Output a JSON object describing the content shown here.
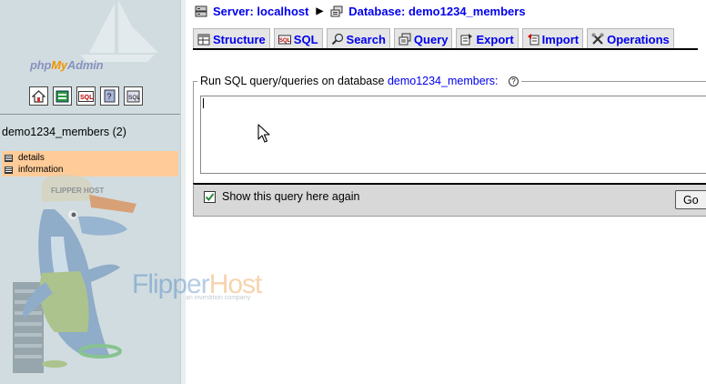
{
  "app": {
    "logo_php": "php",
    "logo_my": "My",
    "logo_admin": "Admin"
  },
  "left": {
    "icons": [
      "home-icon",
      "query-window-icon",
      "sql-icon",
      "help-icon",
      "docs-icon"
    ],
    "database_label": "demo1234_members (2)",
    "tables": [
      {
        "label": "details",
        "icon": "table-icon"
      },
      {
        "label": "information",
        "icon": "table-icon"
      }
    ],
    "watermark_brand": "FlipperHost",
    "watermark_brand_first": "Flipper",
    "watermark_brand_second": "Host",
    "watermark_tagline": "an investition company",
    "mascot_cap_text": "FLIPPER HOST"
  },
  "breadcrumb": {
    "server_label": "Server: localhost",
    "database_label": "Database: demo1234_members"
  },
  "tabs": [
    {
      "label": "Structure",
      "icon": "structure-icon"
    },
    {
      "label": "SQL",
      "icon": "sql-icon"
    },
    {
      "label": "Search",
      "icon": "search-icon"
    },
    {
      "label": "Query",
      "icon": "query-icon"
    },
    {
      "label": "Export",
      "icon": "export-icon"
    },
    {
      "label": "Import",
      "icon": "import-icon"
    },
    {
      "label": "Operations",
      "icon": "operations-icon"
    }
  ],
  "sql_form": {
    "legend_text": "Run SQL query/queries on database",
    "legend_db": "demo1234_members:",
    "help_glyph": "?",
    "query_value": "",
    "show_again_label": "Show this query here again",
    "show_again_checked": true,
    "go_label": "Go"
  },
  "colors": {
    "link": "#0000ee",
    "left_bg": "#d0dce0",
    "highlight": "#ffcc99",
    "php_brand": "#8892bf",
    "my_brand": "#f29400"
  }
}
